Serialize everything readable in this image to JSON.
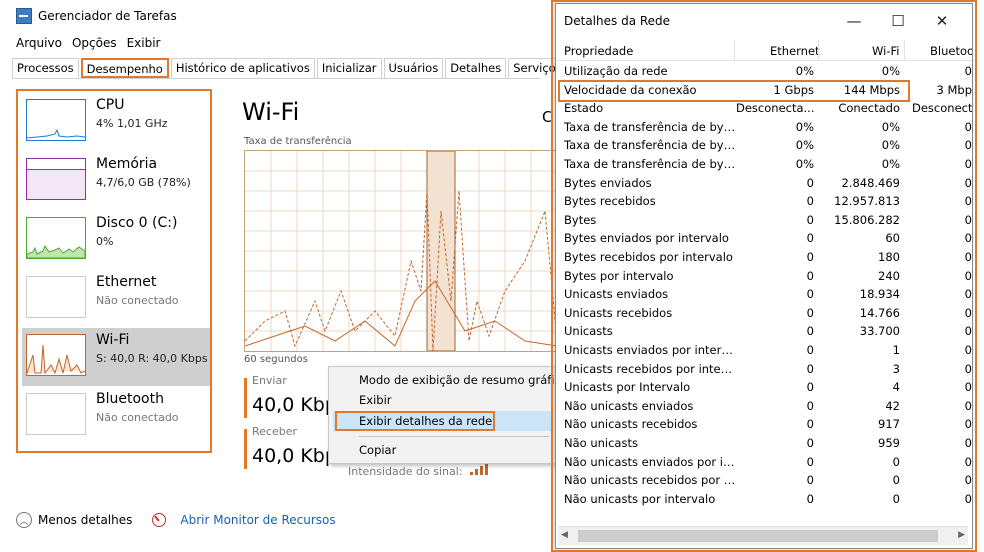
{
  "taskmgr": {
    "title": "Gerenciador de Tarefas",
    "menu": [
      "Arquivo",
      "Opções",
      "Exibir"
    ],
    "tabs": [
      "Processos",
      "Desempenho",
      "Histórico de aplicativos",
      "Inicializar",
      "Usuários",
      "Detalhes",
      "Serviços"
    ],
    "active_tab": "Desempenho",
    "sidebar": [
      {
        "name": "CPU",
        "sub": "4% 1,01 GHz",
        "color": "#1c7cd5"
      },
      {
        "name": "Memória",
        "sub": "4,7/6,0 GB (78%)",
        "color": "#8e2fb1"
      },
      {
        "name": "Disco 0 (C:)",
        "sub": "0%",
        "color": "#4ea72e"
      },
      {
        "name": "Ethernet",
        "sub": "Não conectado",
        "color": "#a0a0a0"
      },
      {
        "name": "Wi-Fi",
        "sub": "S: 40,0 R: 40,0 Kbps",
        "color": "#c4662a"
      },
      {
        "name": "Bluetooth",
        "sub": "Não conectado",
        "color": "#a0a0a0"
      }
    ],
    "panel": {
      "title": "Wi-Fi",
      "title_right_partial": "C",
      "graph_label": "Taxa de transferência",
      "seconds_label": "60 segundos",
      "send_label": "Enviar",
      "send_value": "40,0 Kbp",
      "recv_label": "Receber",
      "recv_value": "40,0 Kbp",
      "signal_label": "Intensidade do sinal:"
    },
    "context_menu": {
      "items": [
        "Modo de exibição de resumo gráfico",
        "Exibir",
        "Exibir detalhes da rede",
        "Copiar"
      ],
      "highlighted": "Exibir detalhes da rede"
    },
    "footer": {
      "less_details": "Menos detalhes",
      "resource_monitor": "Abrir Monitor de Recursos"
    },
    "accent_color": "#e07a2a"
  },
  "network_details": {
    "title": "Detalhes da Rede",
    "columns": [
      "Propriedade",
      "Ethernet",
      "Wi-Fi",
      "Bluetoo"
    ],
    "rows": [
      [
        "Utilização da rede",
        "0%",
        "0%",
        "0"
      ],
      [
        "Velocidade da conexão",
        "1 Gbps",
        "144 Mbps",
        "3 Mbp"
      ],
      [
        "Estado",
        "Desconecta...",
        "Conectado",
        "Desconecta"
      ],
      [
        "Taxa de transferência de bytes ...",
        "0%",
        "0%",
        "0"
      ],
      [
        "Taxa de transferência de bytes r...",
        "0%",
        "0%",
        "0"
      ],
      [
        "Taxa de transferência de bytes",
        "0%",
        "0%",
        "0"
      ],
      [
        "Bytes enviados",
        "0",
        "2.848.469",
        "0"
      ],
      [
        "Bytes recebidos",
        "0",
        "12.957.813",
        "0"
      ],
      [
        "Bytes",
        "0",
        "15.806.282",
        "0"
      ],
      [
        "Bytes enviados por intervalo",
        "0",
        "60",
        "0"
      ],
      [
        "Bytes recebidos por intervalo",
        "0",
        "180",
        "0"
      ],
      [
        "Bytes por intervalo",
        "0",
        "240",
        "0"
      ],
      [
        "Unicasts enviados",
        "0",
        "18.934",
        "0"
      ],
      [
        "Unicasts recebidos",
        "0",
        "14.766",
        "0"
      ],
      [
        "Unicasts",
        "0",
        "33.700",
        "0"
      ],
      [
        "Unicasts enviados por intervalo",
        "0",
        "1",
        "0"
      ],
      [
        "Unicasts recebidos por intervalo",
        "0",
        "3",
        "0"
      ],
      [
        "Unicasts por Intervalo",
        "0",
        "4",
        "0"
      ],
      [
        "Não unicasts enviados",
        "0",
        "42",
        "0"
      ],
      [
        "Não unicasts recebidos",
        "0",
        "917",
        "0"
      ],
      [
        "Não unicasts",
        "0",
        "959",
        "0"
      ],
      [
        "Não unicasts enviados por inte...",
        "0",
        "0",
        "0"
      ],
      [
        "Não unicasts recebidos por inte...",
        "0",
        "0",
        "0"
      ],
      [
        "Não unicasts por intervalo",
        "0",
        "0",
        "0"
      ]
    ],
    "highlighted_row": "Velocidade da conexão"
  }
}
